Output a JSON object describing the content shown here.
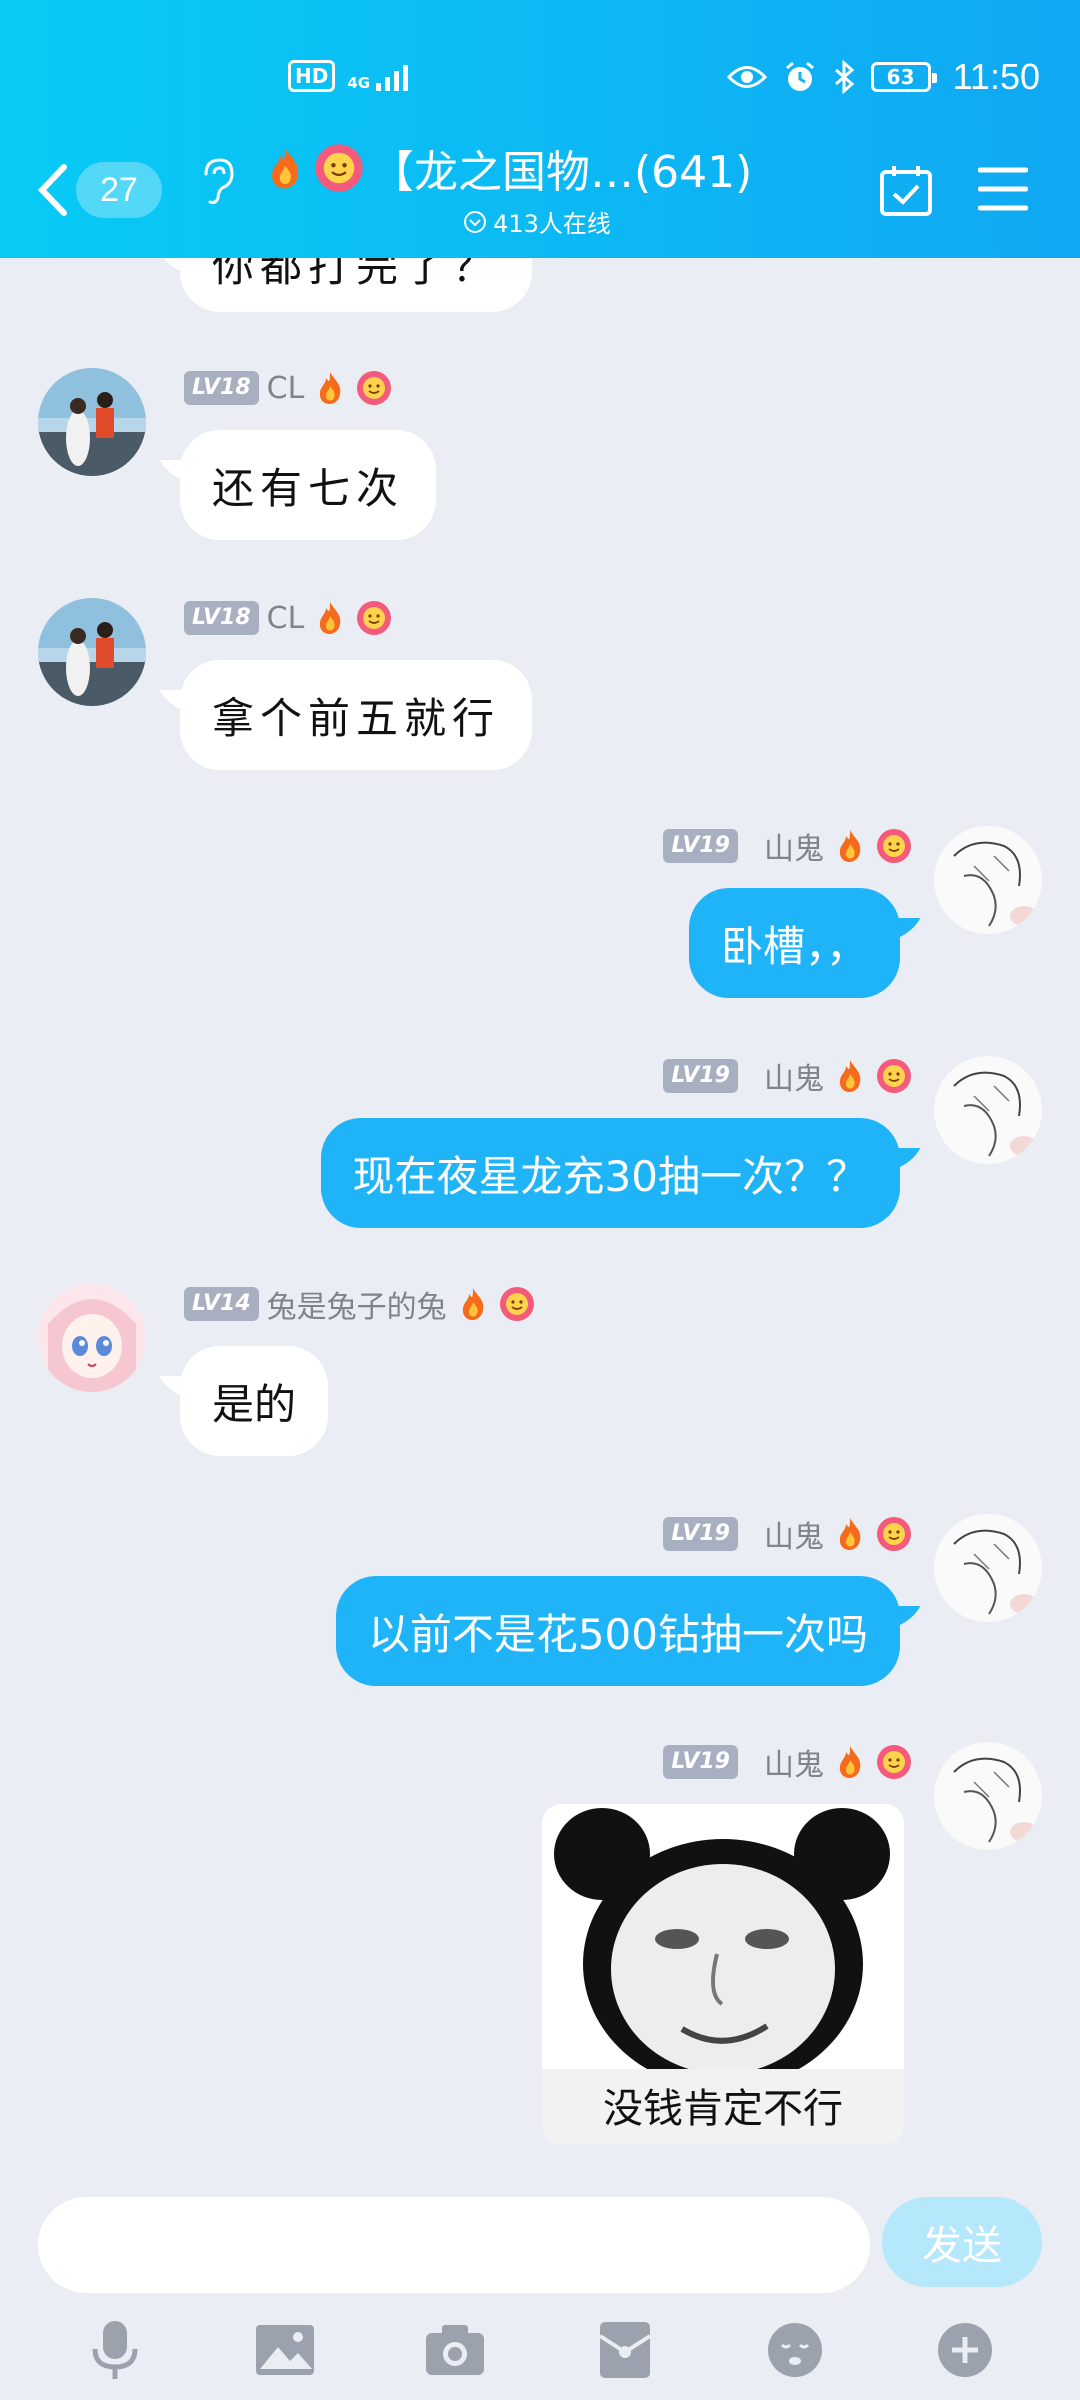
{
  "status_bar": {
    "hd": "HD",
    "network": "4G",
    "battery": "63",
    "time": "11:50"
  },
  "navbar": {
    "unread_count": "27",
    "group_title": "【龙之国物…(641)",
    "online_text": "413人在线"
  },
  "messages": [
    {
      "side": "left",
      "level": "LV18",
      "nick": "CL",
      "text": "还有七次",
      "avatar": "couple-photo-avatar"
    },
    {
      "side": "left",
      "level": "LV18",
      "nick": "CL",
      "text": "拿个前五就行",
      "avatar": "couple-photo-avatar"
    },
    {
      "side": "right",
      "level": "LV19",
      "nick": "山鬼",
      "text": "卧槽，，",
      "avatar": "sketch-avatar"
    },
    {
      "side": "right",
      "level": "LV19",
      "nick": "山鬼",
      "text": "现在夜星龙充30抽一次？？",
      "avatar": "sketch-avatar"
    },
    {
      "side": "left",
      "level": "LV14",
      "nick": "兔是兔子的兔",
      "text": "是的",
      "avatar": "anime-girl-avatar"
    },
    {
      "side": "right",
      "level": "LV19",
      "nick": "山鬼",
      "text": "以前不是花500钻抽一次吗",
      "avatar": "sketch-avatar"
    },
    {
      "side": "right",
      "level": "LV19",
      "nick": "山鬼",
      "sticker_caption": "没钱肯定不行",
      "avatar": "sketch-avatar"
    }
  ],
  "partial_top_message": {
    "text": "你都打完了？"
  },
  "input": {
    "placeholder": "",
    "send_label": "发送"
  },
  "toolbar": [
    "microphone-icon",
    "image-icon",
    "camera-icon",
    "red-packet-icon",
    "emoji-icon",
    "plus-icon"
  ],
  "colors": {
    "header_start": "#08CBF5",
    "header_end": "#10A8F3",
    "bubble_self": "#1FB4F7",
    "background": "#EAEDF3"
  }
}
